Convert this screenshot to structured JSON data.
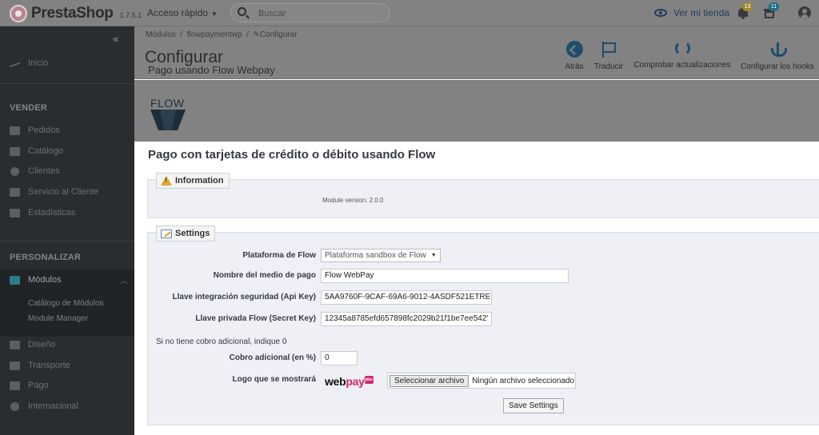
{
  "topbar": {
    "brand": "PrestaShop",
    "version": "1.7.5.1",
    "quick_access": "Acceso rápido",
    "search_placeholder": "Buscar",
    "view_store": "Ver mi tienda",
    "notifications_badge": "13",
    "gift_badge": "11"
  },
  "sidebar": {
    "collapse_glyph": "«",
    "home": "Inicio",
    "sell_heading": "VENDER",
    "sell_items": [
      "Pedidos",
      "Catálogo",
      "Clientes",
      "Servicio al Cliente",
      "Estadísticas"
    ],
    "customize_heading": "PERSONALIZAR",
    "modules": "Módulos",
    "modules_sub": [
      "Catálogo de Módulos",
      "Module Manager"
    ],
    "other_items": [
      "Diseño",
      "Transporte",
      "Pago",
      "Internacional"
    ]
  },
  "header": {
    "breadcrumb": [
      "Módulos",
      "flowpaymentwp",
      "Configurar"
    ],
    "title": "Configurar",
    "subtitle": "Pago usando Flow Webpay",
    "toolbar": [
      {
        "label": "Atrás",
        "icon": "back-arrow-icon"
      },
      {
        "label": "Traducir",
        "icon": "flag-icon"
      },
      {
        "label": "Comprobar actualizaciones",
        "icon": "refresh-icon"
      },
      {
        "label": "Configurar los hooks",
        "icon": "anchor-icon"
      }
    ]
  },
  "module": {
    "logo_word": "FLOW",
    "title": "Pago con tarjetas de crédito o débito usando Flow",
    "info_legend": "Information",
    "version_text": "Module version: 2.0.0",
    "settings_legend": "Settings",
    "platform_label": "Plataforma de Flow",
    "platform_value": "Plataforma sandbox de Flow",
    "payment_name_label": "Nombre del medio de pago",
    "payment_name_value": "Flow WebPay",
    "api_key_label": "Llave integración seguridad (Api Key)",
    "api_key_value": "5AA9760F-9CAF-69A6-9012-4ASDF521ETRE",
    "secret_key_label": "Llave privada Flow (Secret Key)",
    "secret_key_value": "12345a8785efd657898fc2029b21f1be7ee542'",
    "extra_note": "Si no tiene cobro adicional, indique 0",
    "extra_label": "Cobro adicional (en %)",
    "extra_value": "0",
    "logo_label": "Logo que se mostrará",
    "webpay_web": "web",
    "webpay_pay": "pay",
    "webpay_plus": "plus",
    "file_button": "Seleccionar archivo",
    "file_status": "Ningún archivo seleccionado",
    "save_button": "Save Settings"
  },
  "colors": {
    "sidebar_bg": "#292d30",
    "overlay_gray": "#828282",
    "accent_blue": "#1f4e6b",
    "webpay_pink": "#d6246e"
  }
}
